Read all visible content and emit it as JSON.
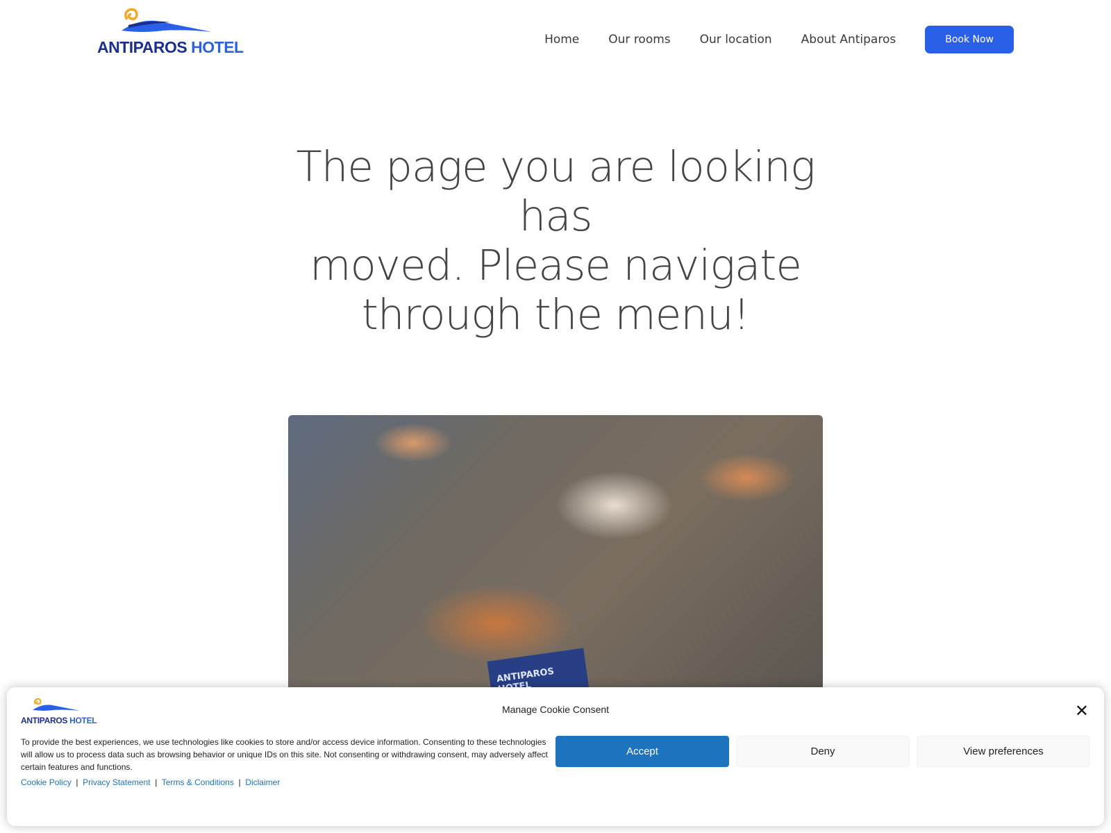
{
  "header": {
    "logo": {
      "word1": "ANTIPAROS",
      "word2": "HOTEL"
    },
    "nav": [
      {
        "label": "Home"
      },
      {
        "label": "Our rooms"
      },
      {
        "label": "Our location"
      },
      {
        "label": "About Antiparos"
      }
    ],
    "book_label": "Book Now"
  },
  "main": {
    "heading_lines": [
      "The page you are looking has",
      "moved. Please navigate",
      "through the menu!"
    ],
    "photo_card_text": "ANTIPAROS HOTEL"
  },
  "cookie": {
    "title": "Manage Cookie Consent",
    "close_icon": "close-icon",
    "text": "To provide the best experiences, we use technologies like cookies to store and/or access device information. Consenting to these technologies will allow us to process data such as browsing behavior or unique IDs on this site. Not consenting or withdrawing consent, may adversely affect certain features and functions.",
    "buttons": {
      "accept": "Accept",
      "deny": "Deny",
      "prefs": "View preferences"
    },
    "links": [
      {
        "label": "Cookie Policy"
      },
      {
        "label": "Privacy Statement"
      },
      {
        "label": "Terms & Conditions"
      },
      {
        "label": "Diclaimer"
      }
    ],
    "separator": "|"
  },
  "colors": {
    "brand_dark": "#1b2f8f",
    "brand_blue": "#2a5fe8",
    "sun_orange": "#f5a623",
    "cookie_accent": "#1e73be"
  }
}
